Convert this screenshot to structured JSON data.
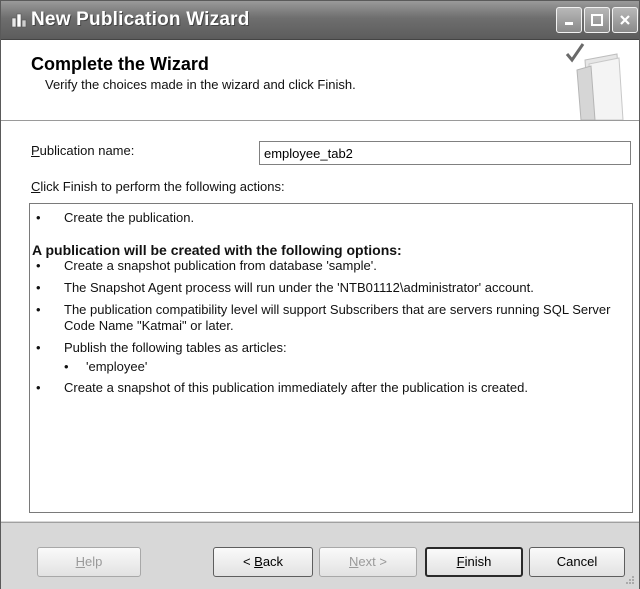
{
  "window": {
    "title": "New Publication Wizard",
    "controls": [
      "minimize-icon",
      "maximize-icon",
      "close-icon"
    ]
  },
  "header": {
    "title": "Complete the Wizard",
    "subtitle": "Verify the choices made in the wizard and click Finish."
  },
  "form": {
    "name_label_u": "P",
    "name_label_rest": "ublication name:",
    "name_value": "employee_tab2",
    "actions_label_u": "C",
    "actions_label_rest": "lick Finish to perform the following actions:"
  },
  "actions": {
    "first": "Create the publication.",
    "options_heading": "A publication will be created with the following options:",
    "items": [
      "Create a snapshot publication from database 'sample'.",
      "The Snapshot Agent process will run under the 'NTB01112\\administrator' account.",
      "The publication compatibility level will support Subscribers that are servers running SQL Server Code Name \"Katmai\" or later.",
      "Publish the following tables as articles:",
      "'employee'",
      "Create a snapshot of this publication immediately after the publication is created."
    ]
  },
  "buttons": {
    "help_u": "H",
    "help_rest": "elp",
    "back_pre": "< ",
    "back_u": "B",
    "back_rest": "ack",
    "next_u": "N",
    "next_rest": "ext >",
    "finish_u": "F",
    "finish_rest": "inish",
    "cancel": "Cancel"
  }
}
